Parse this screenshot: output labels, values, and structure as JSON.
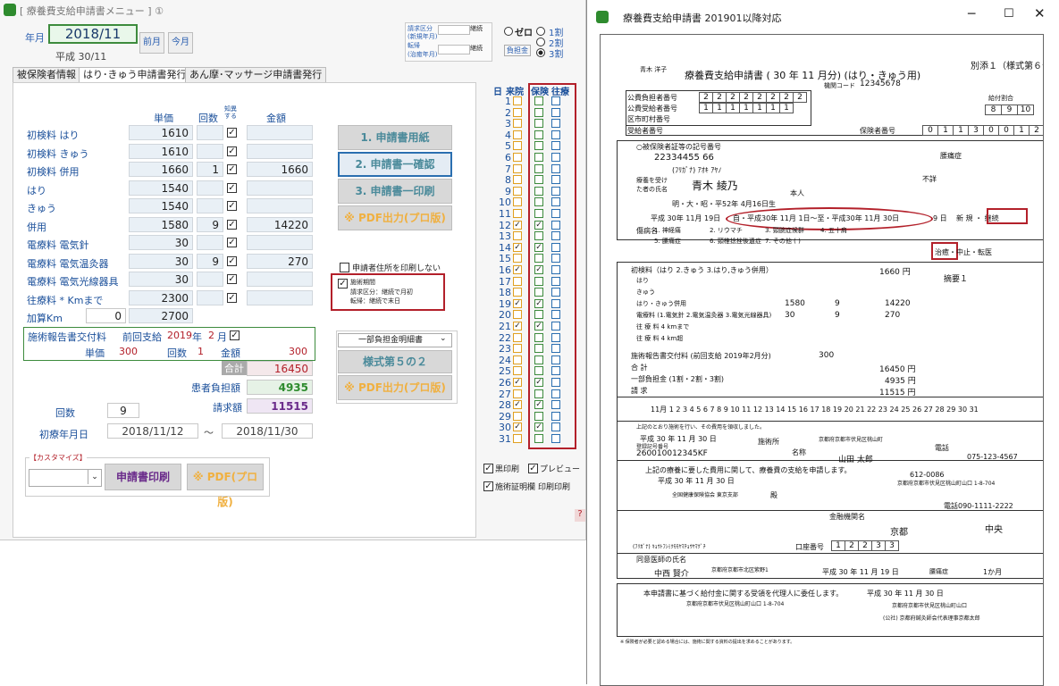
{
  "left_window": {
    "title": "[ 療養費支給申請書メニュー ]  ①",
    "year_month_label": "年月",
    "year_month_value": "2018/11",
    "heisei_label": "平成 30/11",
    "prev_month": "前月",
    "this_month": "今月",
    "request_box": {
      "l1": "請求区分",
      "l2": "(新規年月)",
      "l3": "転帰",
      "l4": "(治癒年月)",
      "b1": "継続",
      "b2": "継続"
    },
    "radio_zero": "ゼロ",
    "radio_1": "1割",
    "radio_2": "2割",
    "radio_3": "3割",
    "burden_label": "負担金",
    "tabs": [
      "被保険者情報",
      "はり･きゅう申請書発行",
      "あん摩･マッサージ申請書発行"
    ],
    "headers": {
      "unit": "単価",
      "count": "回数",
      "knowledge": "知異する",
      "amount": "金額"
    },
    "rows": [
      {
        "label": "初検料  はり",
        "unit": "1610",
        "count": "",
        "amount": ""
      },
      {
        "label": "初検料  きゅう",
        "unit": "1610",
        "count": "",
        "amount": ""
      },
      {
        "label": "初検料  併用",
        "unit": "1660",
        "count": "1",
        "amount": "1660"
      },
      {
        "label": "はり",
        "unit": "1540",
        "count": "",
        "amount": ""
      },
      {
        "label": "きゅう",
        "unit": "1540",
        "count": "",
        "amount": ""
      },
      {
        "label": "併用",
        "unit": "1580",
        "count": "9",
        "amount": "14220"
      },
      {
        "label": "電療料  電気針",
        "unit": "30",
        "count": "",
        "amount": ""
      },
      {
        "label": "電療料  電気温灸器",
        "unit": "30",
        "count": "9",
        "amount": "270"
      },
      {
        "label": "電療料  電気光線器具",
        "unit": "30",
        "count": "",
        "amount": ""
      },
      {
        "label": "往療料  * Kmまで",
        "unit": "2300",
        "count": "",
        "amount": ""
      },
      {
        "label": "加算Km",
        "unit": "2700",
        "count": "",
        "amount": "",
        "extra": "0"
      }
    ],
    "report": {
      "label": "施術報告書交付料",
      "prev": "前回支給",
      "year": "2019",
      "year_label": "年",
      "month": "2",
      "month_label": "月",
      "unit_label": "単価",
      "unit": "300",
      "count_label": "回数",
      "count": "1",
      "amount_label": "金額",
      "amount": "300"
    },
    "total_label": "合計",
    "total": "16450",
    "patient_label": "患者負担額",
    "patient": "4935",
    "claim_label": "請求額",
    "claim": "11515",
    "times_label": "回数",
    "times": "9",
    "first_date_label": "初療年月日",
    "first_date": "2018/11/12",
    "tilde": "〜",
    "last_date": "2018/11/30",
    "buttons": [
      "1. 申請書用紙",
      "2. 申請書一確認",
      "3. 申請書一印刷",
      "※ PDF出力(プロ版)"
    ],
    "print_addr": "申請者住所を印刷しない",
    "period_title": "施術期間",
    "period_l1": "請求区分：継続で月初",
    "period_l2": "転帰：継続で末日",
    "select_value": "一部負担金明細書",
    "style52": "様式第５の２",
    "pdf2": "※ PDF出力(プロ版)",
    "custom_label": "【カスタマイズ】",
    "print_btn": "申請書印刷",
    "pdf3": "※ PDF(プロ版)",
    "day_header": {
      "day": "日",
      "visit": "来院",
      "ins": "保険",
      "out": "往療"
    },
    "days": [
      "1",
      "2",
      "3",
      "4",
      "5",
      "6",
      "7",
      "8",
      "9",
      "10",
      "11",
      "12",
      "13",
      "14",
      "15",
      "16",
      "17",
      "18",
      "19",
      "20",
      "21",
      "22",
      "23",
      "24",
      "25",
      "26",
      "27",
      "28",
      "29",
      "30",
      "31"
    ],
    "visit_days": [
      12,
      14,
      16,
      19,
      21,
      26,
      28,
      30
    ],
    "black_print": "黒印刷",
    "preview": "プレビュー",
    "cert_col": "施術証明欄",
    "print_print": "印刷印刷",
    "help": "?"
  },
  "right_window": {
    "title": "療養費支給申請書    201901以降対応",
    "form_title": "療養費支給申請書 ( 30 年 11 月分) (はり・きゅう用)",
    "appendix": "別添１（様式第６号）",
    "name_small": "青木 洋子",
    "inst_code_label": "機関コード",
    "inst_code": "12345678",
    "public1_label": "公費負担者番号",
    "public1": [
      "2",
      "2",
      "2",
      "2",
      "2",
      "2",
      "2",
      "2"
    ],
    "public2_label": "公費受給者番号",
    "public2": [
      "1",
      "1",
      "1",
      "1",
      "1",
      "1",
      "1"
    ],
    "city_label": "区市町村番号",
    "insured_label": "受給者番号",
    "insurer_label": "保険者番号",
    "insurer_no": [
      "0",
      "1",
      "1",
      "3",
      "0",
      "0",
      "1",
      "2"
    ],
    "benefit_ratio": "給付割合",
    "ratios": [
      "8",
      "9",
      "10"
    ],
    "card_label": "○被保険者証等の記号番号",
    "card_no": "22334455  66",
    "patient_label": "療養を受けた者の氏名",
    "patient_kana": "(ﾌﾘｶﾞﾅ) ｱｵｷ ｱﾔﾉ",
    "patient_name": "青木 綾乃",
    "birth": "明・大・昭・平52年 4月16日生",
    "relation": "本人",
    "injury_label": "傷病名",
    "injury": "腰痛症",
    "cause": "不詳",
    "first_date": "平成 30年 11月 19日",
    "period": "自・平成30年 11月 1日〜至・平成30年 11月 30日",
    "days": "9  日",
    "category": "新  規 ・ 継続",
    "disease_label": "傷病名",
    "disease_opts": [
      "1. 神経痛",
      "2. リウマチ",
      "3. 頸腕症候群",
      "4. 五十肩",
      "5. 腰痛症",
      "6. 頸椎捻挫後遺症",
      "7. その他 (  )"
    ],
    "outcome": "治癒・中止・転医",
    "fee_first": "初検料（はり 2.きゅう 3.はり,きゅう併用）",
    "fee_first_amt": "1660 円",
    "fee_rows": [
      {
        "label": "はり",
        "unit": "",
        "count": "",
        "amount": ""
      },
      {
        "label": "きゅう",
        "unit": "",
        "count": "",
        "amount": ""
      },
      {
        "label": "はり・きゅう併用",
        "unit": "1580",
        "count": "9",
        "amount": "14220"
      },
      {
        "label": "電療料 (1.電気針 2.電気温灸器 3.電気光線器具)",
        "unit": "30",
        "count": "9",
        "amount": "270"
      },
      {
        "label": "往 療 料     4 kmまで",
        "unit": "",
        "count": "",
        "amount": ""
      },
      {
        "label": "往 療 料     4 km超",
        "unit": "",
        "count": "",
        "amount": ""
      }
    ],
    "report_row": "施術報告書交付料 (前回支給 2019年2月分)",
    "report_amt": "300",
    "total_label": "合                計",
    "total": "16450 円",
    "burden_label": "一部負担金 (1割・2割・3割)",
    "burden": "4935 円",
    "claim_label": "請                求",
    "claim": "11515 円",
    "remark": "摘要１",
    "dates_line": "11月  1 2 3 4 5 6 7 8 9 10 11 12 13 14 15 16 17 18 19 20 21 22 23 24 25 26 27 28 29 30 31",
    "cert": "上記のとおり施術を行い、その費用を領収しました。",
    "cert_date": "平成 30 年 11 月 30 日",
    "reg_no_label": "登録記号番号",
    "reg_no": "260010012345KF",
    "clinic_addr_label": "施術所",
    "clinic_addr": "京都府京都市伏見区桃山町",
    "clinic_name_label": "名称",
    "practitioner": "山田  太郎",
    "tel_label": "電話",
    "tel": "075-123-4567",
    "applicant_text": "上記の療養に要した費用に関して、療養費の支給を申請します。",
    "apply_date": "平成 30 年 11 月 30 日",
    "zip": "612-0086",
    "apply_addr": "京都府京都市伏見区桃山町山口 1-8-704",
    "insurer_name": "全国健康保険協会  東京支部",
    "dono": "殿",
    "tel2": "電話090-1111-2222",
    "bank_label": "金融機関名",
    "bank": "京都",
    "branch": "中央",
    "acct_label": "口座番号",
    "acct": [
      "1",
      "2",
      "2",
      "3",
      "3"
    ],
    "acct_kana": "(ﾌﾘｶﾞﾅ) ｷｮｳﾄﾌｼﾐｸﾓﾓﾔﾏﾁｮｳﾔﾏｸﾞﾁ",
    "doctor_label": "同意医師の氏名",
    "doctor": "中西  賢介",
    "doctor_addr": "京都府京都市北区紫野1",
    "consent_date": "平成 30 年 11 月 19 日",
    "consent_disease": "腰痛症",
    "consent_period": "1か月",
    "delegate_text": "本申請書に基づく給付金に関する受領を代理人に委任します。",
    "delegate_date": "平成 30 年 11 月 30 日",
    "delegate_addr": "京都府京都市伏見区桃山町山口 1-8-704",
    "agent_addr": "京都府京都市伏見区桃山町山口",
    "agent_name": "(公社) 京都府鍼灸師会代表理事京都太郎",
    "footnote": "※ 保険者が必要と認める場合には、施術に関する資料の提出を求めることがあります。"
  }
}
